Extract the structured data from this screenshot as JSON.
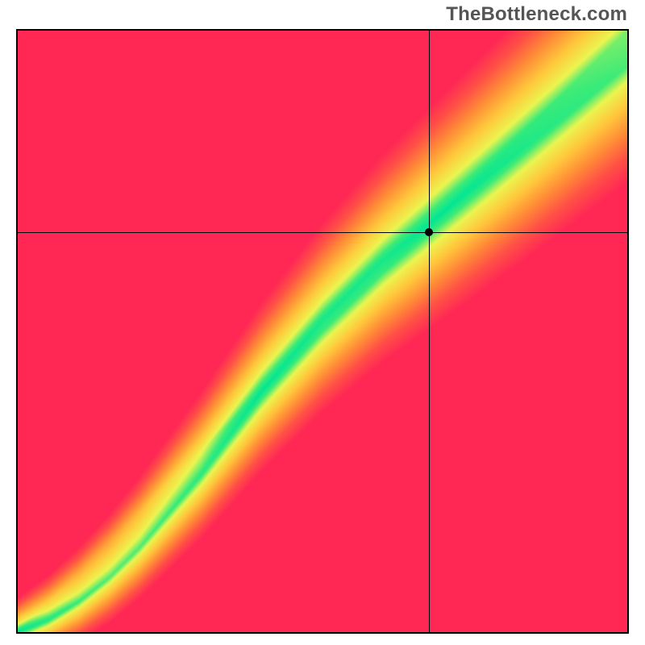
{
  "watermark": "TheBottleneck.com",
  "chart_data": {
    "type": "heatmap",
    "title": "",
    "xlabel": "",
    "ylabel": "",
    "xlim": [
      0,
      100
    ],
    "ylim": [
      0,
      100
    ],
    "crosshair": {
      "x": 67.5,
      "y": 66.5
    },
    "marker": {
      "x": 67.5,
      "y": 66.5
    },
    "colorscale_description": "Diverging red→orange→yellow→green, green along a monotone optimal curve from bottom-left to top-right; far off-curve is red.",
    "curve_points": [
      {
        "x": 0,
        "y": 0
      },
      {
        "x": 5,
        "y": 2
      },
      {
        "x": 10,
        "y": 5
      },
      {
        "x": 15,
        "y": 9
      },
      {
        "x": 20,
        "y": 14
      },
      {
        "x": 25,
        "y": 20
      },
      {
        "x": 30,
        "y": 26
      },
      {
        "x": 35,
        "y": 33
      },
      {
        "x": 40,
        "y": 40
      },
      {
        "x": 45,
        "y": 46
      },
      {
        "x": 50,
        "y": 52
      },
      {
        "x": 55,
        "y": 57
      },
      {
        "x": 60,
        "y": 62
      },
      {
        "x": 65,
        "y": 66
      },
      {
        "x": 70,
        "y": 70
      },
      {
        "x": 75,
        "y": 74
      },
      {
        "x": 80,
        "y": 78
      },
      {
        "x": 85,
        "y": 82
      },
      {
        "x": 90,
        "y": 86
      },
      {
        "x": 95,
        "y": 90
      },
      {
        "x": 100,
        "y": 94
      }
    ],
    "grid": false,
    "legend": false
  }
}
